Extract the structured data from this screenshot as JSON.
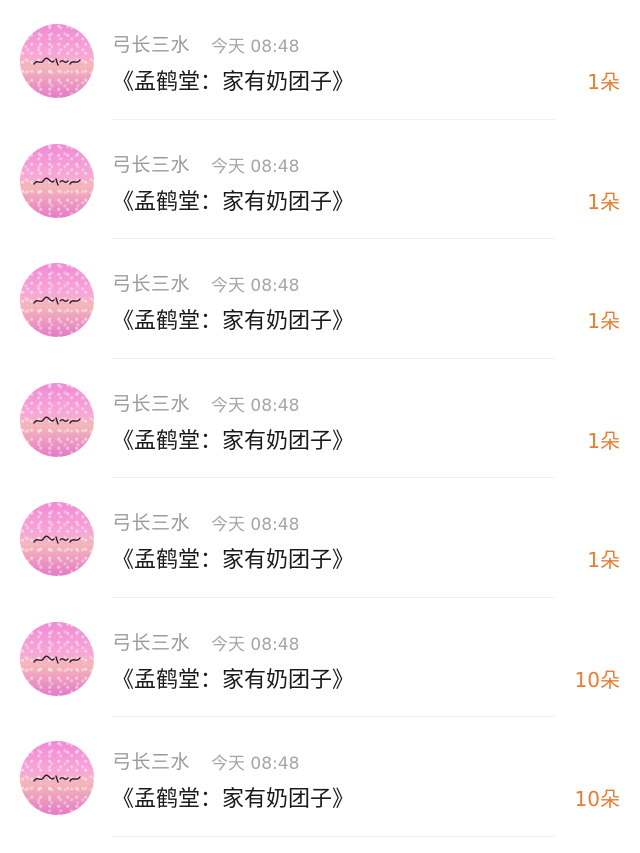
{
  "colors": {
    "amount": "#ec7b2d",
    "sender": "#9a9a9a",
    "title": "#1a1a1a"
  },
  "messages": [
    {
      "sender": "弓长三水",
      "time": "今天 08:48",
      "title": "《孟鹤堂：家有奶团子》",
      "amount": "1朵"
    },
    {
      "sender": "弓长三水",
      "time": "今天 08:48",
      "title": "《孟鹤堂：家有奶团子》",
      "amount": "1朵"
    },
    {
      "sender": "弓长三水",
      "time": "今天 08:48",
      "title": "《孟鹤堂：家有奶团子》",
      "amount": "1朵"
    },
    {
      "sender": "弓长三水",
      "time": "今天 08:48",
      "title": "《孟鹤堂：家有奶团子》",
      "amount": "1朵"
    },
    {
      "sender": "弓长三水",
      "time": "今天 08:48",
      "title": "《孟鹤堂：家有奶团子》",
      "amount": "1朵"
    },
    {
      "sender": "弓长三水",
      "time": "今天 08:48",
      "title": "《孟鹤堂：家有奶团子》",
      "amount": "10朵"
    },
    {
      "sender": "弓长三水",
      "time": "今天 08:48",
      "title": "《孟鹤堂：家有奶团子》",
      "amount": "10朵"
    }
  ]
}
